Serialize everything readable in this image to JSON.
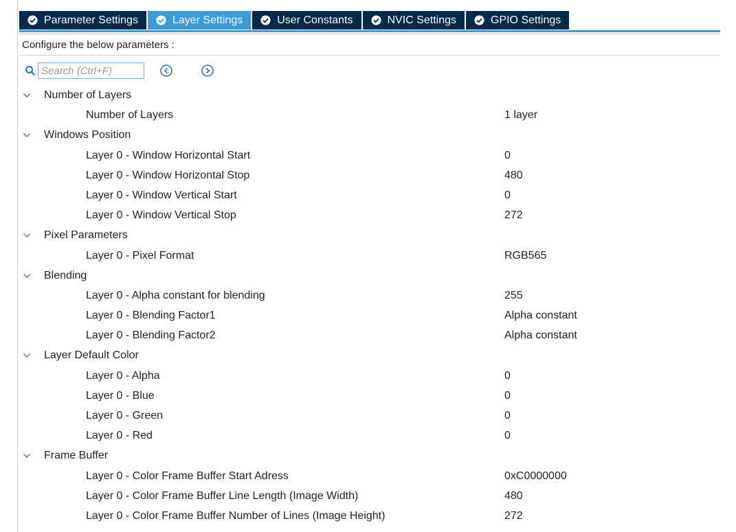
{
  "tabs": [
    {
      "label": "Parameter Settings",
      "active": false
    },
    {
      "label": "Layer Settings",
      "active": true
    },
    {
      "label": "User Constants",
      "active": false
    },
    {
      "label": "NVIC Settings",
      "active": false
    },
    {
      "label": "GPIO Settings",
      "active": false
    }
  ],
  "configure_text": "Configure the below parameters :",
  "search": {
    "placeholder": "Search (Ctrl+F)"
  },
  "colors": {
    "tab_bg": "#04294a",
    "tab_active": "#3a9bd6",
    "text": "#222222"
  },
  "groups": [
    {
      "label": "Number of Layers",
      "params": [
        {
          "label": "Number of Layers",
          "value": "1 layer"
        }
      ]
    },
    {
      "label": "Windows Position",
      "params": [
        {
          "label": "Layer 0 - Window Horizontal Start",
          "value": "0"
        },
        {
          "label": "Layer 0 - Window Horizontal Stop",
          "value": "480"
        },
        {
          "label": "Layer 0 - Window Vertical Start",
          "value": "0"
        },
        {
          "label": "Layer 0 - Window Vertical Stop",
          "value": "272"
        }
      ]
    },
    {
      "label": "Pixel Parameters",
      "params": [
        {
          "label": "Layer 0 - Pixel Format",
          "value": "RGB565"
        }
      ]
    },
    {
      "label": "Blending",
      "params": [
        {
          "label": "Layer 0 - Alpha constant for blending",
          "value": "255"
        },
        {
          "label": "Layer 0 - Blending Factor1",
          "value": "Alpha constant"
        },
        {
          "label": "Layer 0 - Blending Factor2",
          "value": "Alpha constant"
        }
      ]
    },
    {
      "label": "Layer Default Color",
      "params": [
        {
          "label": "Layer 0 - Alpha",
          "value": "0"
        },
        {
          "label": "Layer 0 - Blue",
          "value": "0"
        },
        {
          "label": "Layer 0 - Green",
          "value": "0"
        },
        {
          "label": "Layer 0 - Red",
          "value": "0"
        }
      ]
    },
    {
      "label": "Frame Buffer",
      "params": [
        {
          "label": "Layer 0 - Color Frame Buffer Start Adress",
          "value": "0xC0000000"
        },
        {
          "label": "Layer 0 - Color Frame Buffer Line Length (Image Width)",
          "value": "480"
        },
        {
          "label": "Layer 0 - Color Frame Buffer Number of Lines (Image Height)",
          "value": "272"
        }
      ]
    }
  ]
}
